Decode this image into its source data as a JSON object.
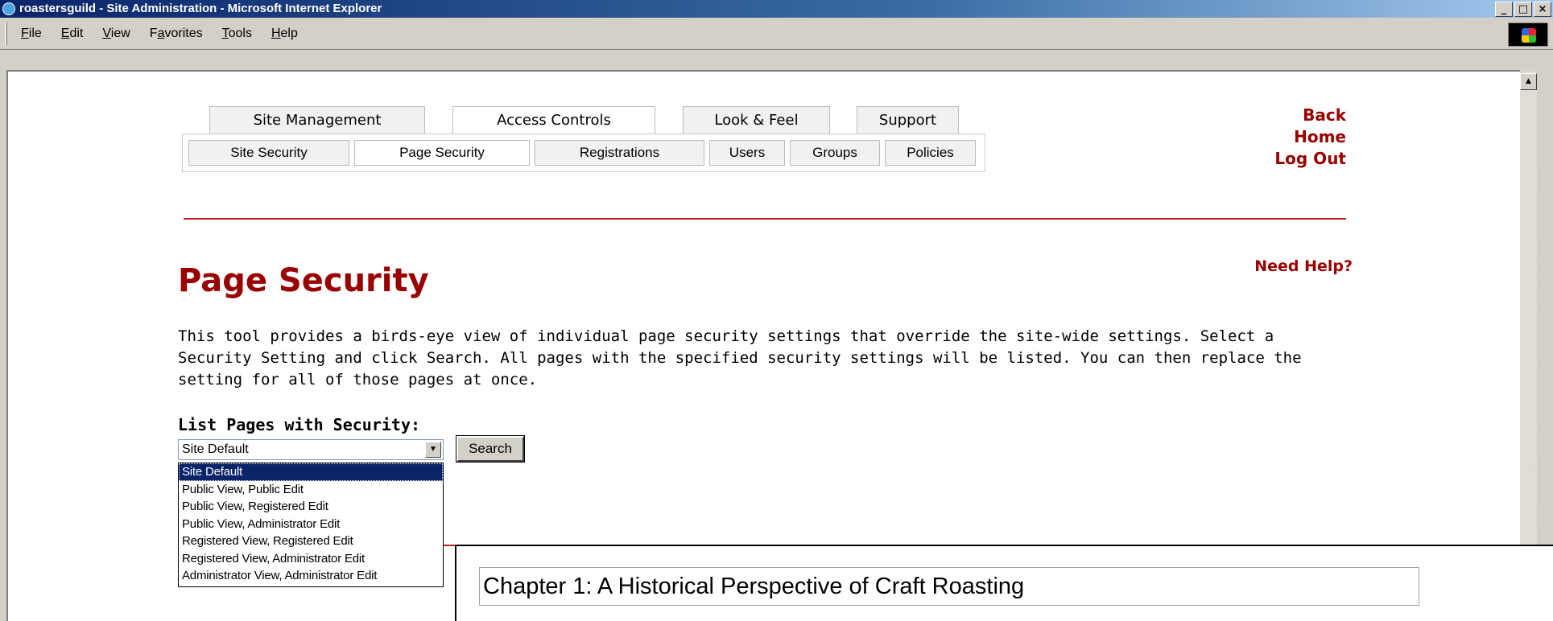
{
  "window": {
    "title": "roastersguild - Site Administration - Microsoft Internet Explorer",
    "controls": [
      "_",
      "□",
      "×"
    ]
  },
  "menubar": {
    "items": [
      {
        "ul": "F",
        "rest": "ile"
      },
      {
        "ul": "E",
        "rest": "dit"
      },
      {
        "ul": "V",
        "rest": "iew"
      },
      {
        "pre": "F",
        "ul": "a",
        "rest": "vorites"
      },
      {
        "ul": "T",
        "rest": "ools"
      },
      {
        "ul": "H",
        "rest": "elp"
      }
    ]
  },
  "tabs": {
    "main": [
      "Site Management",
      "Access Controls",
      "Look & Feel",
      "Support"
    ],
    "active_main": "Access Controls",
    "sub": [
      "Site Security",
      "Page Security",
      "Registrations",
      "Users",
      "Groups",
      "Policies"
    ],
    "active_sub": "Page Security"
  },
  "links": {
    "back": "Back",
    "home": "Home",
    "logout": "Log Out",
    "need_help": "Need Help?"
  },
  "page": {
    "title": "Page Security",
    "description": "This tool provides a birds-eye view of individual page security settings that override the site-wide settings. Select a Security Setting and click Search. All pages with the specified security settings will be listed. You can then replace the setting for all of those pages at once.",
    "list_label": "List Pages with Security:",
    "select_value": "Site Default",
    "search_button": "Search",
    "options": [
      "Site Default",
      "Public View, Public Edit",
      "Public View, Registered Edit",
      "Public View, Administrator Edit",
      "Registered View, Registered Edit",
      "Registered View, Administrator Edit",
      "Administrator View, Administrator Edit"
    ]
  },
  "overlay": {
    "chapter_title": "Chapter 1: A Historical Perspective of Craft Roasting"
  },
  "colors": {
    "accent_red": "#990000",
    "titlebar_blue": "#0a246a",
    "selection_blue": "#0a246a"
  }
}
